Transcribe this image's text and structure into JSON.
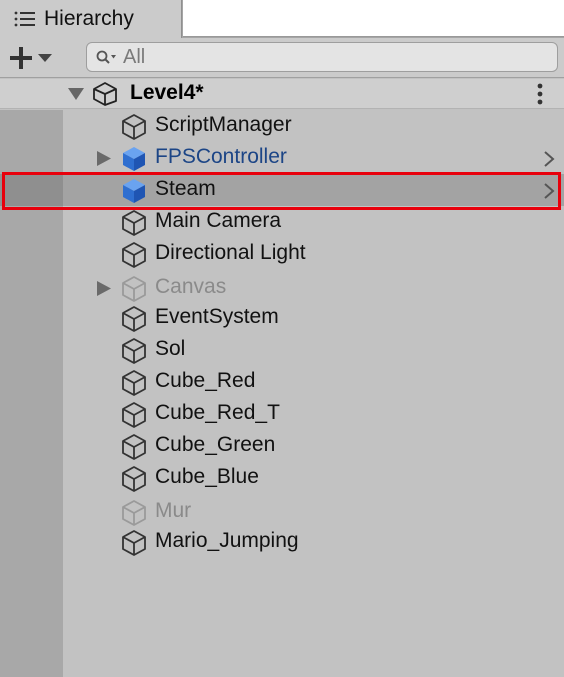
{
  "tab": {
    "label": "Hierarchy",
    "icon": "list-icon"
  },
  "toolbar": {
    "add_icon": "plus-icon",
    "dropdown_icon": "caret-down-icon",
    "search": {
      "placeholder": "All",
      "value": "",
      "icon": "search-icon"
    }
  },
  "scene": {
    "name": "Level4*",
    "icon": "unity-scene-icon",
    "menu_icon": "kebab-menu-icon"
  },
  "items": [
    {
      "label": "ScriptManager",
      "kind": "gameobject",
      "expandable": false,
      "active": true,
      "selected": false
    },
    {
      "label": "FPSController",
      "kind": "prefab",
      "expandable": true,
      "active": true,
      "selected": false
    },
    {
      "label": "Steam",
      "kind": "prefab-selected",
      "expandable": false,
      "active": true,
      "selected": true
    },
    {
      "label": "Main Camera",
      "kind": "gameobject",
      "expandable": false,
      "active": true,
      "selected": false
    },
    {
      "label": "Directional Light",
      "kind": "gameobject",
      "expandable": false,
      "active": true,
      "selected": false
    },
    {
      "label": "Canvas",
      "kind": "gameobject",
      "expandable": true,
      "active": false,
      "selected": false
    },
    {
      "label": "EventSystem",
      "kind": "gameobject",
      "expandable": false,
      "active": true,
      "selected": false
    },
    {
      "label": "Sol",
      "kind": "gameobject",
      "expandable": false,
      "active": true,
      "selected": false
    },
    {
      "label": "Cube_Red",
      "kind": "gameobject",
      "expandable": false,
      "active": true,
      "selected": false
    },
    {
      "label": "Cube_Red_T",
      "kind": "gameobject",
      "expandable": false,
      "active": true,
      "selected": false
    },
    {
      "label": "Cube_Green",
      "kind": "gameobject",
      "expandable": false,
      "active": true,
      "selected": false
    },
    {
      "label": "Cube_Blue",
      "kind": "gameobject",
      "expandable": false,
      "active": true,
      "selected": false
    },
    {
      "label": "Mur",
      "kind": "gameobject",
      "expandable": false,
      "active": false,
      "selected": false
    },
    {
      "label": "Mario_Jumping",
      "kind": "gameobject",
      "expandable": false,
      "active": true,
      "selected": false
    }
  ],
  "colors": {
    "prefab_text": "#1c4586",
    "inactive_text": "#8a8a8a",
    "highlight": "#e8000c",
    "prefab_cube": "#3a7bd5"
  }
}
